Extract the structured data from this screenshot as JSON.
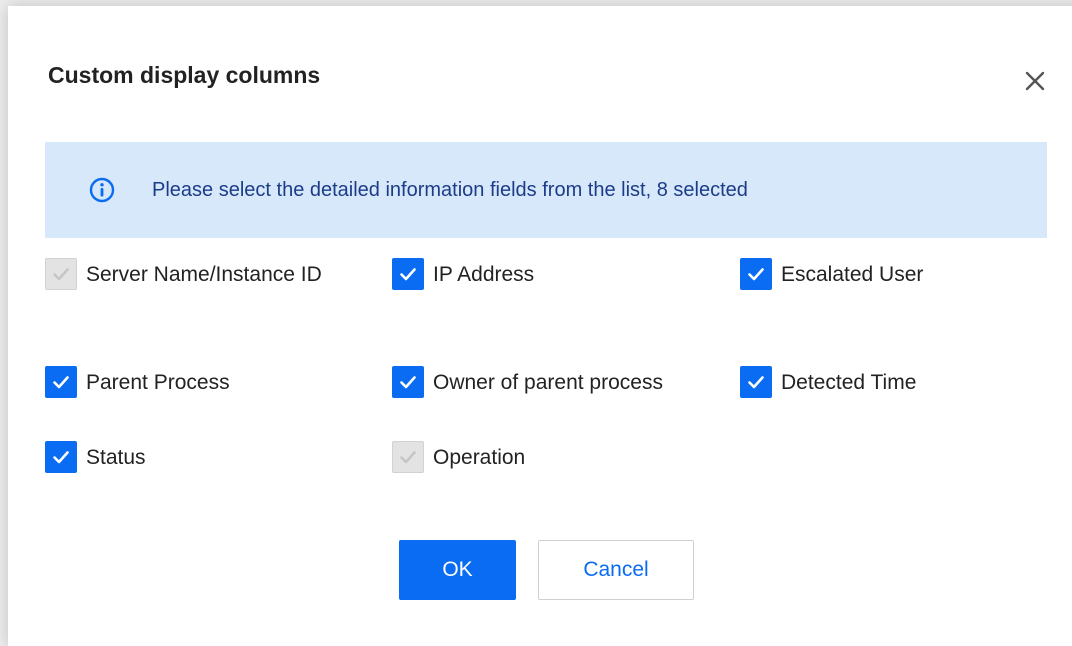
{
  "dialog": {
    "title": "Custom display columns",
    "close_icon": "close-icon",
    "info": {
      "icon": "info-icon",
      "text": "Please select the detailed information fields from the list, 8 selected"
    },
    "options": [
      {
        "label": "Server Name/Instance ID",
        "checked": true,
        "disabled": true
      },
      {
        "label": "IP Address",
        "checked": true,
        "disabled": false
      },
      {
        "label": "Escalated User",
        "checked": true,
        "disabled": false
      },
      {
        "label": "Parent Process",
        "checked": true,
        "disabled": false
      },
      {
        "label": "Owner of parent process",
        "checked": true,
        "disabled": false
      },
      {
        "label": "Detected Time",
        "checked": true,
        "disabled": false
      },
      {
        "label": "Status",
        "checked": true,
        "disabled": false
      },
      {
        "label": "Operation",
        "checked": true,
        "disabled": true
      }
    ],
    "ok_label": "OK",
    "cancel_label": "Cancel"
  },
  "colors": {
    "accent": "#0a6cf2",
    "info_bg": "#d7e8fb",
    "info_text": "#1c3c87",
    "disabled_checkbox": "#e3e3e3"
  }
}
